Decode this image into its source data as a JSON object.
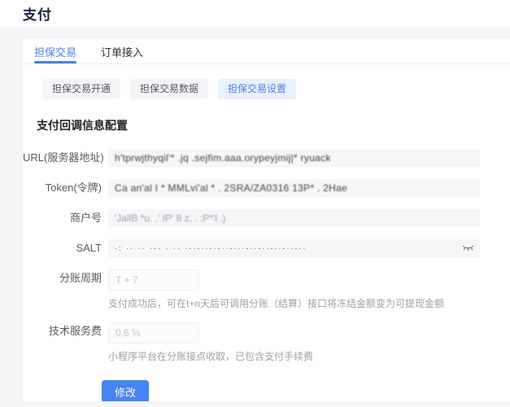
{
  "theme": {
    "accent": "#4a7df0",
    "accent_light": "#e9f0fd",
    "submit_blue": "#4584f2"
  },
  "page": {
    "title": "支付"
  },
  "tabs": [
    {
      "label": "担保交易",
      "active": true
    },
    {
      "label": "订单接入",
      "active": false
    }
  ],
  "toolbar": {
    "buttons": [
      {
        "label": "担保交易开通",
        "active": false
      },
      {
        "label": "担保交易数据",
        "active": false
      },
      {
        "label": "担保交易设置",
        "active": true
      }
    ]
  },
  "section": {
    "title": "支付回调信息配置"
  },
  "form": {
    "url": {
      "label": "URL(服务器地址)",
      "value": "h'tprwjthyqil'* .jq .sejfim.aaa.orypeyjmij|* ryuack",
      "redacted": "true"
    },
    "token": {
      "label": "Token(令牌)",
      "value": "Ca an'al I * MMLvi'al * .  2SRA/ZA0316 13P* . 2Hae",
      "redacted": "true"
    },
    "merchant": {
      "label": "商户号",
      "value": "'JallB *u. .' IP' 8 z. . :P*'l   .)",
      "redacted": "true"
    },
    "salt": {
      "label": "SALT",
      "value": "·: ·· ·· ·-· · ·· ·-·-··-·-··-···-··-··-··-··-··",
      "masked": "true",
      "toggle_icon": "eye-invisible-icon"
    },
    "cycle": {
      "label": "分账周期",
      "value": "T + 7",
      "help": "支付成功后，可在t+n天后可调用分账（结算）接口将冻结金额变为可提现金额"
    },
    "fee": {
      "label": "技术服务费",
      "value": "0.6 %",
      "help": "小程序平台在分账接点收取，已包含支付手续费"
    }
  },
  "actions": {
    "submit_label": "修改"
  }
}
